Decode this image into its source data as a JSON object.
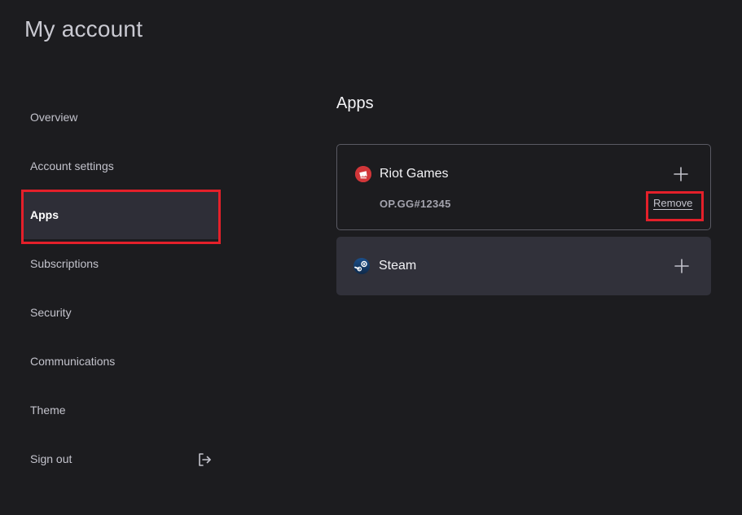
{
  "header": {
    "title": "My account"
  },
  "sidebar": {
    "items": [
      {
        "label": "Overview"
      },
      {
        "label": "Account settings"
      },
      {
        "label": "Apps"
      },
      {
        "label": "Subscriptions"
      },
      {
        "label": "Security"
      },
      {
        "label": "Communications"
      },
      {
        "label": "Theme"
      },
      {
        "label": "Sign out"
      }
    ],
    "active": "Apps",
    "signout_icon": "sign-out-icon"
  },
  "main": {
    "title": "Apps",
    "apps": [
      {
        "name": "Riot Games",
        "icon": "riot-games-icon",
        "account_id": "OP.GG#12345",
        "action_label": "Remove",
        "expanded": true
      },
      {
        "name": "Steam",
        "icon": "steam-icon",
        "expanded": false
      }
    ]
  },
  "colors": {
    "background": "#1c1c1f",
    "active_item": "#2e2e37",
    "highlight": "#e4202a",
    "riot_red": "#d13639",
    "card_collapsed": "#31313a"
  }
}
